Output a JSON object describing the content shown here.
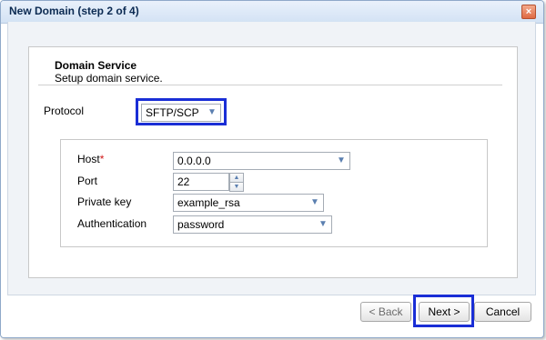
{
  "window": {
    "title": "New Domain (step 2 of 4)",
    "close_glyph": "×"
  },
  "section": {
    "title": "Domain Service",
    "subtitle": "Setup domain service."
  },
  "protocol": {
    "label": "Protocol",
    "value": "SFTP/SCP"
  },
  "fields": {
    "host": {
      "label": "Host",
      "required_mark": "*",
      "value": "0.0.0.0"
    },
    "port": {
      "label": "Port",
      "value": "22"
    },
    "private_key": {
      "label": "Private key",
      "value": "example_rsa"
    },
    "authentication": {
      "label": "Authentication",
      "value": "password"
    }
  },
  "buttons": {
    "back": "< Back",
    "next": "Next >",
    "cancel": "Cancel"
  },
  "icons": {
    "dropdown": "chevron-down-icon",
    "spin_up": "spin-up-icon",
    "spin_down": "spin-down-icon"
  },
  "colors": {
    "highlight": "#1a2ed6",
    "title_text": "#0b2a52",
    "close_button": "#df6a43",
    "required": "#d01818"
  }
}
